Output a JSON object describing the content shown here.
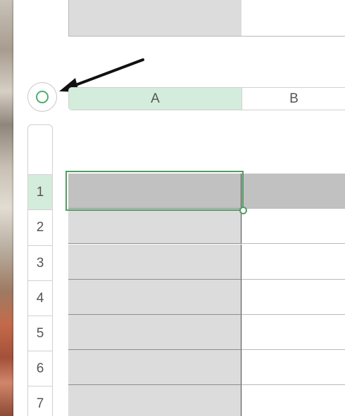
{
  "spreadsheet": {
    "columns": [
      {
        "label": "A",
        "selected": true
      },
      {
        "label": "B",
        "selected": false
      }
    ],
    "rows": [
      {
        "label": "1",
        "selected": true
      },
      {
        "label": "2",
        "selected": false
      },
      {
        "label": "3",
        "selected": false
      },
      {
        "label": "4",
        "selected": false
      },
      {
        "label": "5",
        "selected": false
      },
      {
        "label": "6",
        "selected": false
      },
      {
        "label": "7",
        "selected": false
      }
    ],
    "selected_cell": "A1"
  },
  "select_all_button": {
    "icon": "circle-icon"
  },
  "annotation": {
    "icon": "arrow-icon",
    "points_to": "select-all-button"
  },
  "colors": {
    "selection_accent": "#4f9e62",
    "header_highlight": "#d4ecdc",
    "row_highlight": "#c1c1c1",
    "column_fill": "#dcdcdc"
  }
}
